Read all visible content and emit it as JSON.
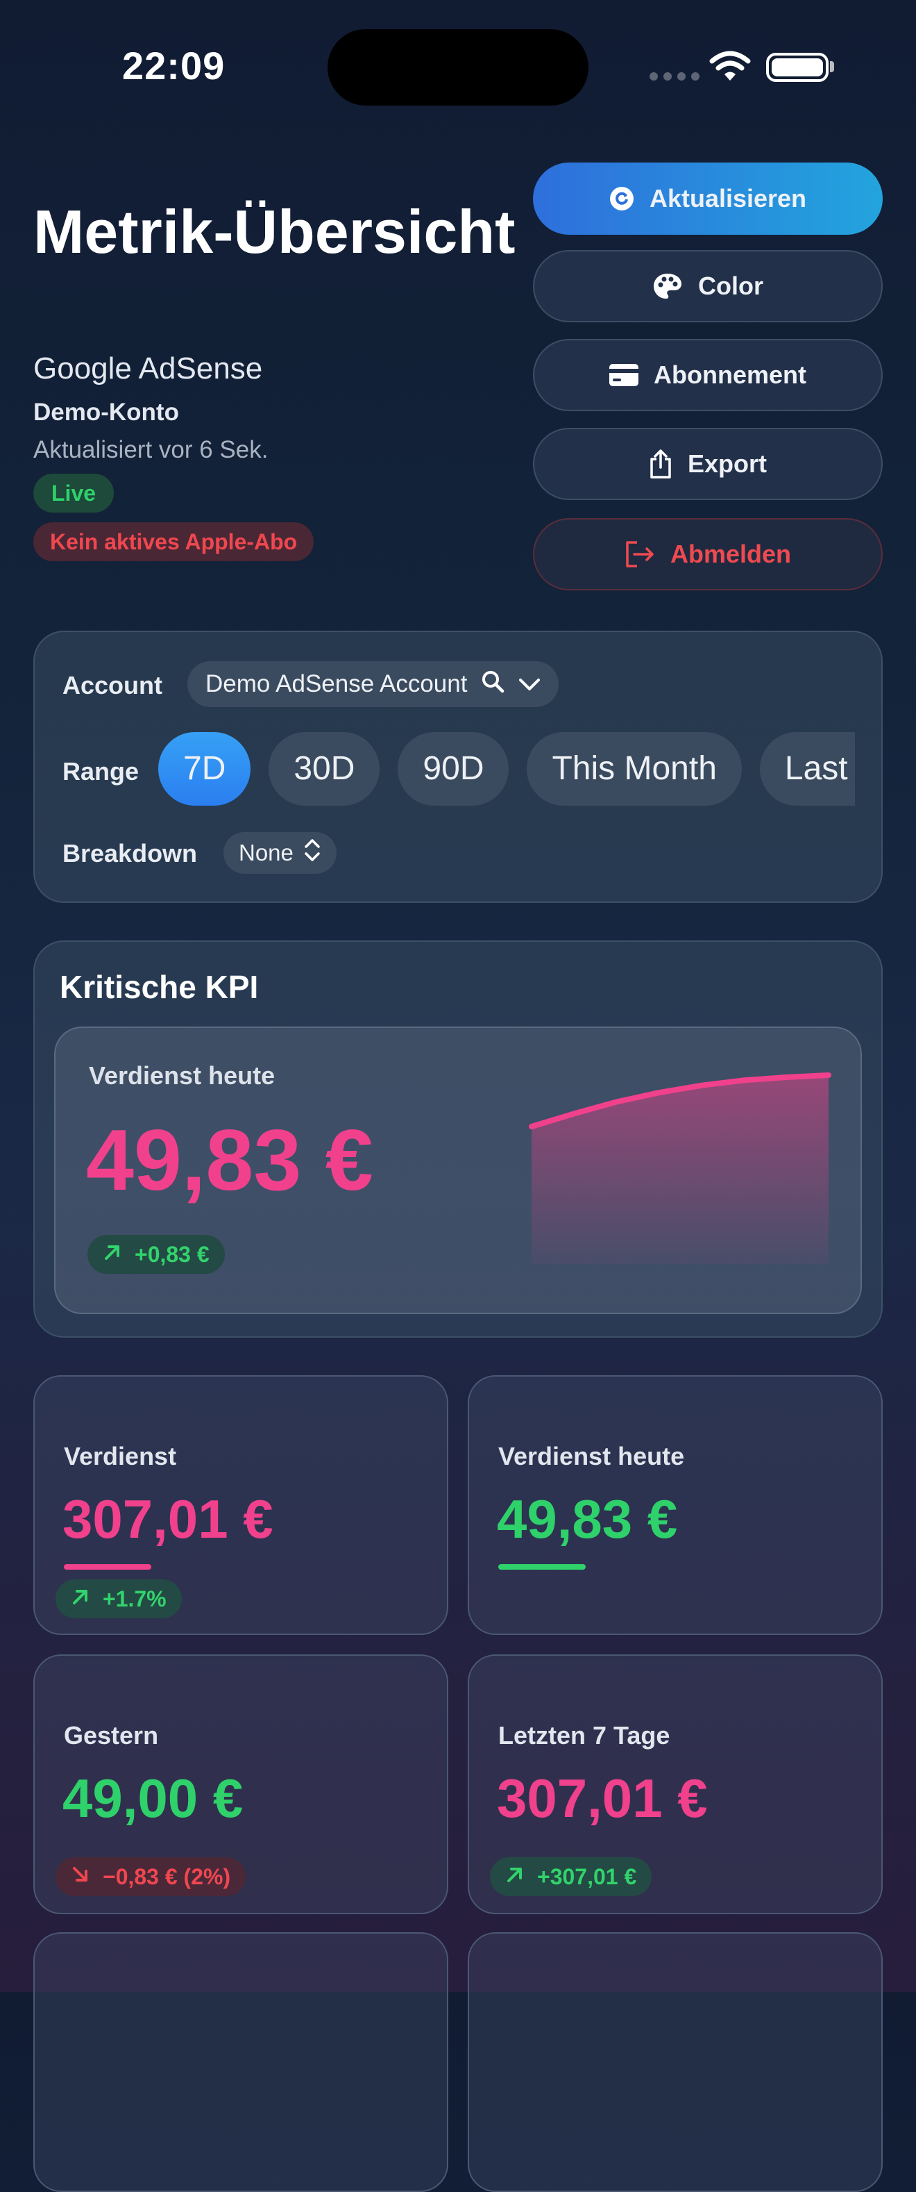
{
  "status": {
    "time": "22:09"
  },
  "header": {
    "title": "Metrik-Übersicht",
    "provider": "Google AdSense",
    "account_type": "Demo-Konto",
    "updated": "Aktualisiert vor 6 Sek.",
    "live_badge": "Live",
    "subscription_badge": "Kein aktives Apple-Abo"
  },
  "actions": {
    "refresh": "Aktualisieren",
    "color": "Color",
    "subscription": "Abonnement",
    "export": "Export",
    "logout": "Abmelden"
  },
  "filters": {
    "account_label": "Account",
    "account_value": "Demo AdSense Account",
    "range_label": "Range",
    "ranges": [
      "7D",
      "30D",
      "90D",
      "This Month",
      "Last Month"
    ],
    "active_range": "7D",
    "breakdown_label": "Breakdown",
    "breakdown_value": "None"
  },
  "kpi": {
    "section_title": "Kritische KPI",
    "label": "Verdienst heute",
    "value": "49,83 €",
    "delta": "+0,83 €",
    "sparkline": [
      0.0,
      0.25,
      0.48,
      0.66,
      0.8,
      0.9,
      0.96,
      1.0
    ]
  },
  "metrics": [
    {
      "label": "Verdienst",
      "value": "307,01 €",
      "color": "#f1418c",
      "delta": "+1.7%",
      "delta_dir": "up"
    },
    {
      "label": "Verdienst heute",
      "value": "49,83 €",
      "color": "#2fd16a",
      "delta": "",
      "delta_dir": ""
    },
    {
      "label": "Gestern",
      "value": "49,00 €",
      "color": "#2fd16a",
      "delta": "−0,83 € (2%)",
      "delta_dir": "down"
    },
    {
      "label": "Letzten 7 Tage",
      "value": "307,01 €",
      "color": "#f1418c",
      "delta": "+307,01 €",
      "delta_dir": "up"
    }
  ],
  "colors": {
    "accent": "#2e8ae8",
    "positive": "#2fd16a",
    "negative": "#f0474f",
    "highlight": "#f1418c"
  }
}
